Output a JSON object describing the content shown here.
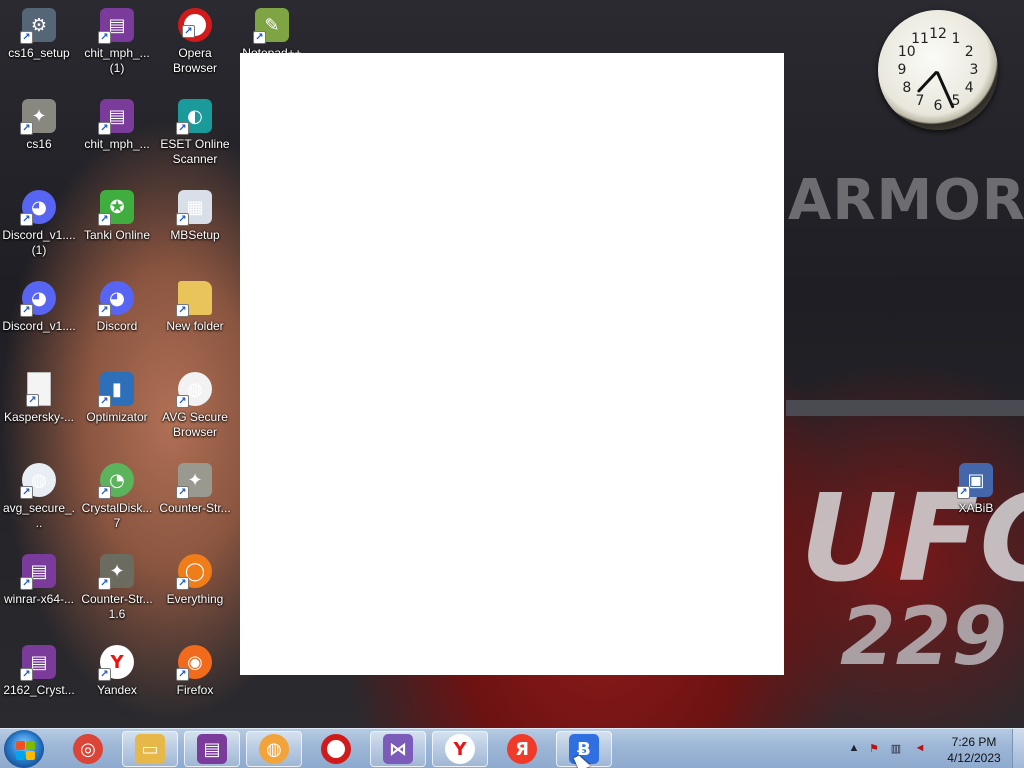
{
  "desktop": {
    "wallpaper_text": [
      "ARMOR",
      "UFC",
      "229"
    ],
    "icons": [
      {
        "label": "cs16_setup",
        "icon": "counter-strike-setup-icon",
        "col": 0,
        "row": 0,
        "color": "#556677",
        "glyph": "⚙"
      },
      {
        "label": "chit_mph_...\n(1)",
        "icon": "winrar-archive-icon",
        "col": 1,
        "row": 0,
        "color": "#7a3b9b",
        "glyph": "▤"
      },
      {
        "label": "Opera Browser",
        "icon": "opera-icon",
        "col": 2,
        "row": 0,
        "color": "#d11a1a",
        "glyph": "O"
      },
      {
        "label": "Notepad++",
        "icon": "notepad-plus-plus-icon",
        "col": 3,
        "row": 0,
        "color": "#7ea444",
        "glyph": "✎"
      },
      {
        "label": "cs16",
        "icon": "counter-strike-icon",
        "col": 0,
        "row": 1,
        "color": "#888880",
        "glyph": "✦"
      },
      {
        "label": "chit_mph_...",
        "icon": "winrar-archive-icon",
        "col": 1,
        "row": 1,
        "color": "#7a3b9b",
        "glyph": "▤"
      },
      {
        "label": "ESET Online Scanner",
        "icon": "eset-scanner-icon",
        "col": 2,
        "row": 1,
        "color": "#1a9a9a",
        "glyph": "◐"
      },
      {
        "label": "Discord_v1....\n(1)",
        "icon": "discord-icon",
        "col": 0,
        "row": 2,
        "color": "#5865f2",
        "glyph": "◕"
      },
      {
        "label": "Tanki Online",
        "icon": "tanki-online-icon",
        "col": 1,
        "row": 2,
        "color": "#3fae3f",
        "glyph": "✪"
      },
      {
        "label": "MBSetup",
        "icon": "malwarebytes-setup-icon",
        "col": 2,
        "row": 2,
        "color": "#d8dfe8",
        "glyph": "▦"
      },
      {
        "label": "Discord_v1....",
        "icon": "discord-icon",
        "col": 0,
        "row": 3,
        "color": "#5865f2",
        "glyph": "◕"
      },
      {
        "label": "Discord",
        "icon": "discord-icon",
        "col": 1,
        "row": 3,
        "color": "#5865f2",
        "glyph": "◕"
      },
      {
        "label": "New folder",
        "icon": "folder-icon",
        "col": 2,
        "row": 3,
        "color": "#e9c45a",
        "glyph": ""
      },
      {
        "label": "Kaspersky-...",
        "icon": "file-icon",
        "col": 0,
        "row": 4,
        "color": "#f4f4f4",
        "glyph": ""
      },
      {
        "label": "Optimizator",
        "icon": "optimizator-icon",
        "col": 1,
        "row": 4,
        "color": "#2d6fb8",
        "glyph": "▮"
      },
      {
        "label": "AVG Secure Browser",
        "icon": "avg-browser-icon",
        "col": 2,
        "row": 4,
        "color": "#f2f2f2",
        "glyph": "◍"
      },
      {
        "label": "avg_secure_...",
        "icon": "avg-installer-icon",
        "col": 0,
        "row": 5,
        "color": "#e8eef4",
        "glyph": "◍"
      },
      {
        "label": "CrystalDisk...\n7",
        "icon": "crystaldisk-icon",
        "col": 1,
        "row": 5,
        "color": "#5bb35b",
        "glyph": "◔"
      },
      {
        "label": "Counter-Str...",
        "icon": "counter-strike-icon",
        "col": 2,
        "row": 5,
        "color": "#999990",
        "glyph": "✦"
      },
      {
        "label": "winrar-x64-...",
        "icon": "winrar-installer-icon",
        "col": 0,
        "row": 6,
        "color": "#7a3b9b",
        "glyph": "▤"
      },
      {
        "label": "Counter-Str...\n1.6",
        "icon": "counter-strike-icon",
        "col": 1,
        "row": 6,
        "color": "#6b6b60",
        "glyph": "✦"
      },
      {
        "label": "Everything",
        "icon": "everything-search-icon",
        "col": 2,
        "row": 6,
        "color": "#ef7d1a",
        "glyph": "◯"
      },
      {
        "label": "2162_Cryst...",
        "icon": "winrar-archive-icon",
        "col": 0,
        "row": 7,
        "color": "#7a3b9b",
        "glyph": "▤"
      },
      {
        "label": "Yandex",
        "icon": "yandex-browser-icon",
        "col": 1,
        "row": 7,
        "color": "#ffffff",
        "glyph": "Y"
      },
      {
        "label": "Firefox",
        "icon": "firefox-icon",
        "col": 2,
        "row": 7,
        "color": "#f26a1b",
        "glyph": "◉"
      },
      {
        "label": "XABiB",
        "icon": "shortcut-app-icon",
        "col": 9,
        "row": 5,
        "color": "#4466aa",
        "glyph": "▣"
      }
    ]
  },
  "clock_gadget": {
    "hour": 7,
    "minute": 26,
    "numbers": [
      "12",
      "1",
      "2",
      "3",
      "4",
      "5",
      "6",
      "7",
      "8",
      "9",
      "10",
      "11"
    ]
  },
  "taskbar": {
    "start_label": "Start",
    "items": [
      {
        "name": "chrome",
        "icon": "chrome-icon",
        "color": "#db4437",
        "glyph": "◎"
      },
      {
        "name": "explorer",
        "icon": "file-explorer-icon",
        "color": "#e6b84a",
        "glyph": "▭"
      },
      {
        "name": "winrar",
        "icon": "winrar-icon",
        "color": "#7a3b9b",
        "glyph": "▤"
      },
      {
        "name": "avg-browser",
        "icon": "avg-browser-icon",
        "color": "#f2a33a",
        "glyph": "◍"
      },
      {
        "name": "opera",
        "icon": "opera-icon",
        "color": "#d11a1a",
        "glyph": "O"
      },
      {
        "name": "visual-studio-installer",
        "icon": "visual-studio-installer-icon",
        "color": "#7b5cb8",
        "glyph": "⋈"
      },
      {
        "name": "yandex-browser",
        "icon": "yandex-browser-icon",
        "color": "#ffffff",
        "glyph": "Y"
      },
      {
        "name": "yandex",
        "icon": "yandex-icon",
        "color": "#f13b2a",
        "glyph": "Я"
      },
      {
        "name": "unknown-app",
        "icon": "app-b-icon",
        "color": "#2f6fe0",
        "glyph": "Ƀ"
      }
    ],
    "tray": {
      "time": "7:26 PM",
      "date": "4/12/2023"
    }
  }
}
